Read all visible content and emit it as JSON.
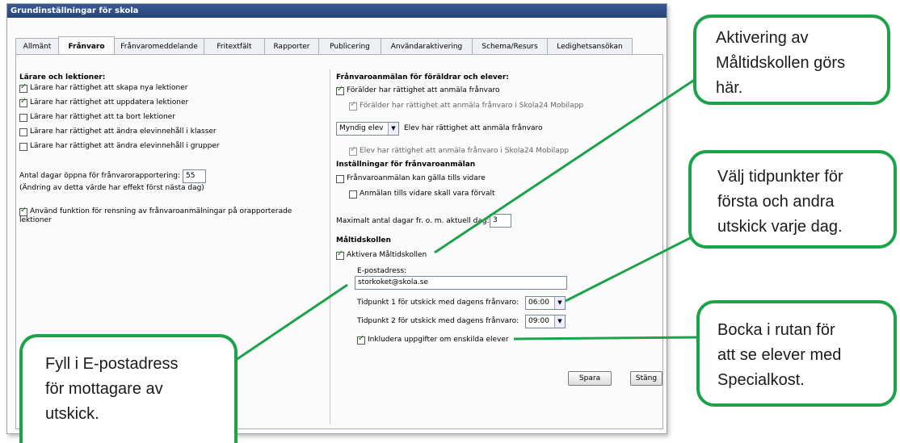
{
  "window": {
    "title": "Grundinställningar för skola"
  },
  "tabs": [
    "Allmänt",
    "Frånvaro",
    "Frånvaromeddelande",
    "Fritextfält",
    "Rapporter",
    "Publicering",
    "Användaraktivering",
    "Schema/Resurs",
    "Ledighetsansökan"
  ],
  "left": {
    "heading": "Lärare och lektioner:",
    "checks": [
      {
        "label": "Lärare har rättighet att skapa nya lektioner",
        "checked": true
      },
      {
        "label": "Lärare har rättighet att uppdatera lektioner",
        "checked": true
      },
      {
        "label": "Lärare har rättighet att ta bort lektioner",
        "checked": false
      },
      {
        "label": "Lärare har rättighet att ändra elevinnehåll i klasser",
        "checked": false
      },
      {
        "label": "Lärare har rättighet att ändra elevinnehåll i grupper",
        "checked": false
      }
    ],
    "days_label": "Antal dagar öppna för frånvarorapportering:",
    "days_value": "55",
    "days_note": "(Ändring av detta värde har effekt först nästa dag)",
    "cleanup_line1": "Använd funktion för rensning av frånvaroanmälningar på orapporterade",
    "cleanup_line2": "lektioner"
  },
  "right": {
    "heading": "Frånvaroanmälan för föräldrar och elever:",
    "parent_right": "Förälder har rättighet att anmäla frånvaro",
    "parent_mobile": "Förälder har rättighet att anmäla frånvaro i Skola24 Mobilapp",
    "student_select": "Myndig elev",
    "student_right": "Elev har rättighet att anmäla frånvaro",
    "student_mobile": "Elev har rättighet att anmäla frånvaro i Skola24 Mobilapp",
    "settings_heading": "Inställningar för frånvaroanmälan",
    "until_further": "Frånvaroanmälan kan gälla tills vidare",
    "until_default": "Anmälan tills vidare skall vara förvalt",
    "max_days_label": "Maximalt antal dagar fr. o. m. aktuell dag:",
    "max_days_value": "3",
    "meal_heading": "Måltidskollen",
    "meal_activate": "Aktivera Måltidskollen",
    "email_label": "E-postadress:",
    "email_value": "storkoket@skola.se",
    "time1_label": "Tidpunkt 1 för utskick med dagens frånvaro:",
    "time1_value": "06:00",
    "time2_label": "Tidpunkt 2 för utskick med dagens frånvaro:",
    "time2_value": "09:00",
    "include_students": "Inkludera uppgifter om enskilda elever"
  },
  "buttons": {
    "save": "Spara",
    "close": "Stäng"
  },
  "callouts": {
    "activate": [
      "Aktivering av",
      "Måltidskollen görs",
      "här."
    ],
    "times": [
      "Välj tidpunkter för",
      "första och andra",
      "utskick varje dag."
    ],
    "special": [
      "Bocka i rutan för",
      "att se elever med",
      "Specialkost."
    ],
    "email": [
      "Fyll i E-postadress",
      "för mottagare av",
      "utskick."
    ]
  },
  "colors": {
    "callout_border": "#1ca34a",
    "titlebar": "#2c4a80"
  }
}
